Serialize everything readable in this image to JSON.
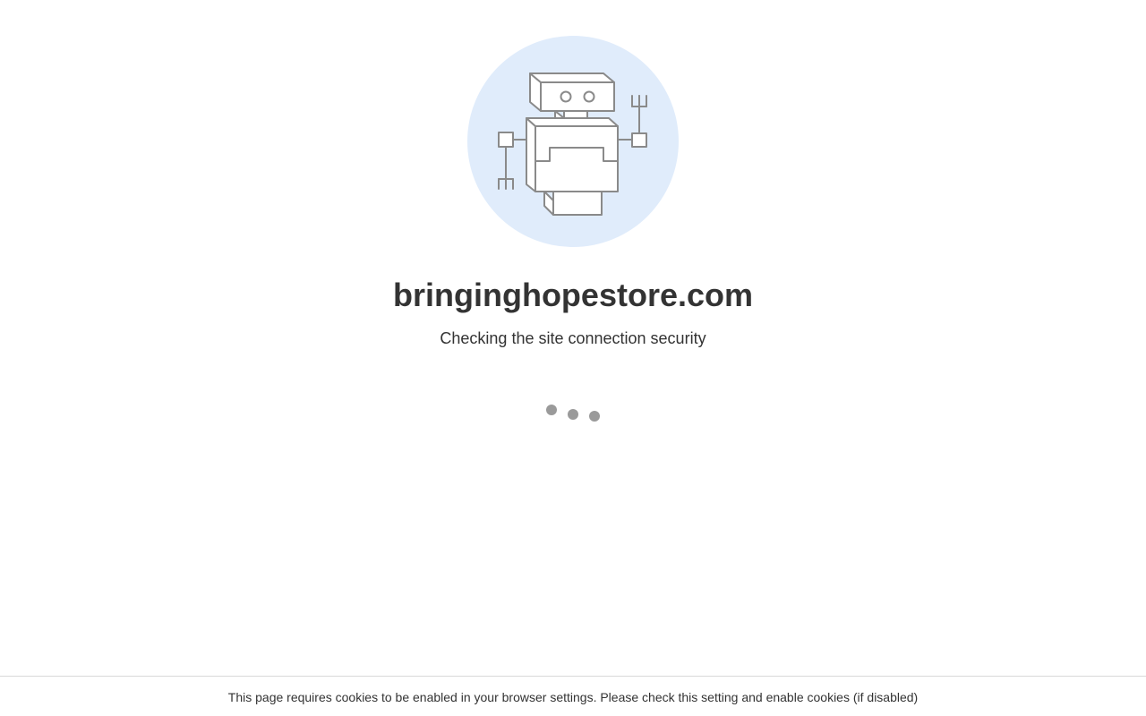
{
  "site": {
    "domain": "bringinghopestore.com",
    "status_text": "Checking the site connection security"
  },
  "illustration": {
    "icon": "robot-icon",
    "background_color": "#e0ecfb",
    "stroke_color": "#8a8a8a"
  },
  "loader": {
    "icon": "loading-dots-icon",
    "dot_color": "#9a9a9a"
  },
  "footer": {
    "message": "This page requires cookies to be enabled in your browser settings. Please check this setting and enable cookies (if disabled)"
  }
}
